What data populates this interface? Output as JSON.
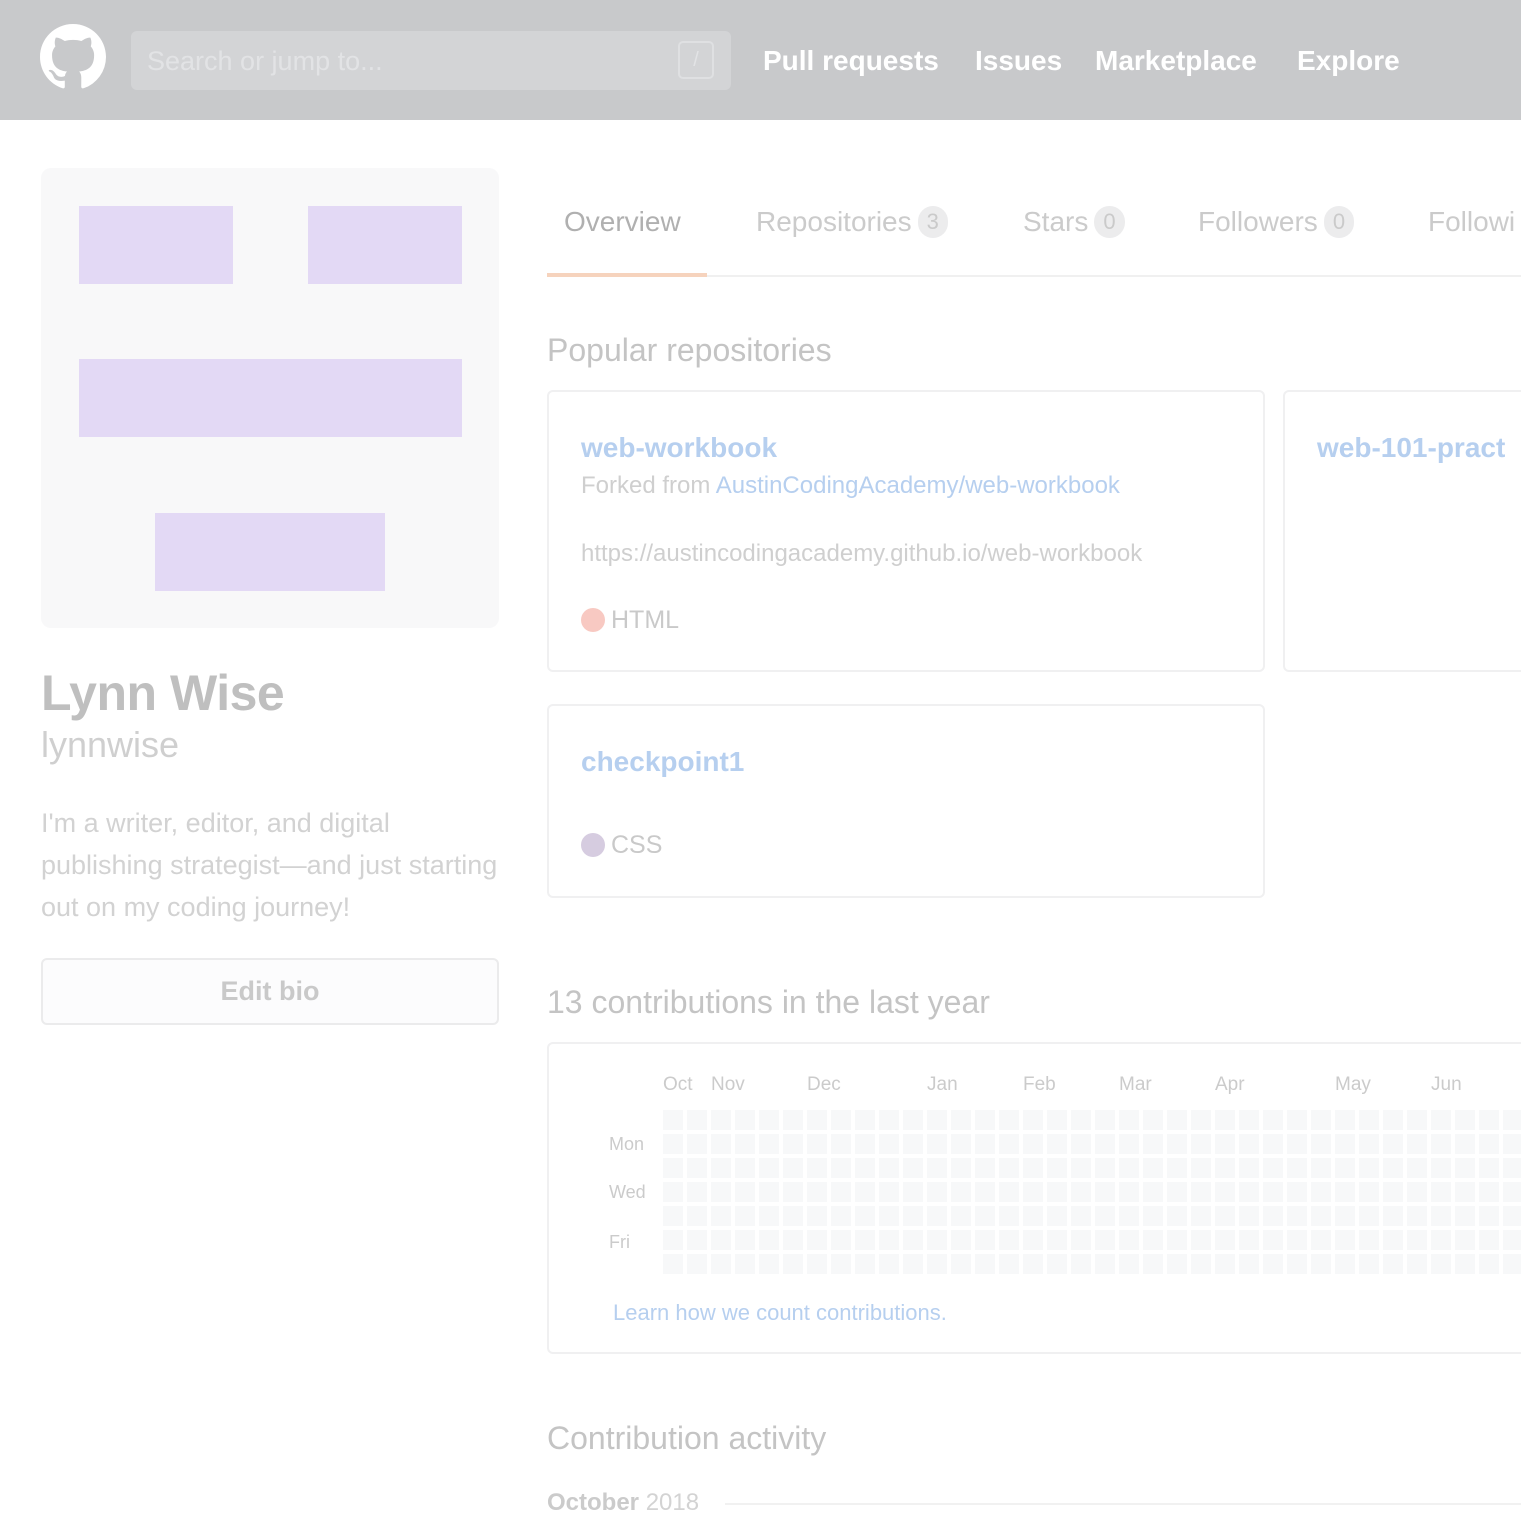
{
  "header": {
    "logo_icon": "github-octocat-icon",
    "search_placeholder": "Search or jump to...",
    "search_shortcut": "/",
    "nav": [
      "Pull requests",
      "Issues",
      "Marketplace",
      "Explore"
    ]
  },
  "profile": {
    "avatar_icon": "identicon-avatar",
    "name": "Lynn Wise",
    "username": "lynnwise",
    "bio": "I'm a writer, editor, and digital publishing strategist—and just starting out on my coding journey!",
    "edit_bio_label": "Edit bio"
  },
  "tabs": [
    {
      "label": "Overview",
      "count": null,
      "active": true
    },
    {
      "label": "Repositories",
      "count": "3",
      "active": false
    },
    {
      "label": "Stars",
      "count": "0",
      "active": false
    },
    {
      "label": "Followers",
      "count": "0",
      "active": false
    },
    {
      "label": "Followi",
      "count": null,
      "active": false
    }
  ],
  "popular": {
    "title": "Popular repositories",
    "repos": [
      {
        "name": "web-workbook",
        "forked_prefix": "Forked from",
        "forked_from": "AustinCodingAcademy/web-workbook",
        "description": "https://austincodingacademy.github.io/web-workbook",
        "language": "HTML",
        "language_color": "#f8c9c2"
      },
      {
        "name": "web-101-pract"
      },
      {
        "name": "checkpoint1",
        "language": "CSS",
        "language_color": "#d6cce0"
      }
    ]
  },
  "contributions": {
    "title": "13 contributions in the last year",
    "months": [
      "Oct",
      "Nov",
      "Dec",
      "Jan",
      "Feb",
      "Mar",
      "Apr",
      "May",
      "Jun"
    ],
    "days": [
      "Mon",
      "Wed",
      "Fri"
    ],
    "learn_link": "Learn how we count contributions.",
    "cell_color": "#f7f8f9"
  },
  "activity": {
    "title": "Contribution activity",
    "month": "October",
    "year": "2018"
  }
}
